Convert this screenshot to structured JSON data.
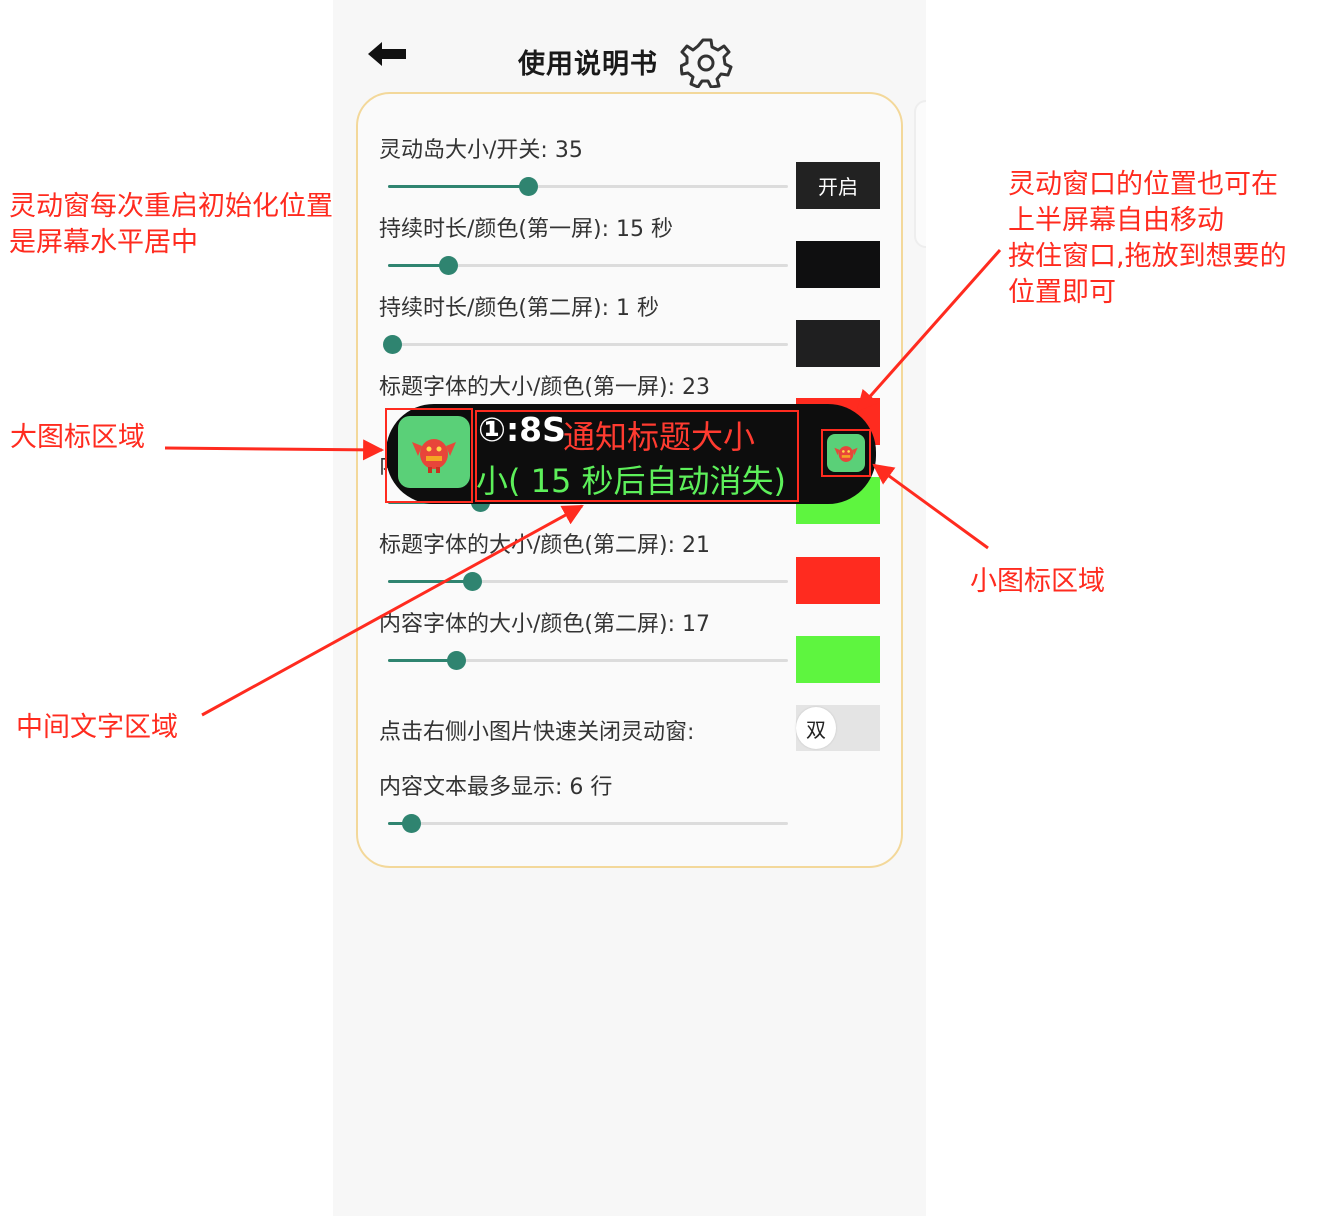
{
  "header": {
    "title": "使用说明书",
    "back_icon": "arrow-left-icon",
    "settings_icon": "gear-icon"
  },
  "settings": [
    {
      "label": "灵动岛大小/开关: 35",
      "value": 35,
      "slider_fraction": 0.35,
      "control": "button",
      "control_label": "开启"
    },
    {
      "label": "持续时长/颜色(第一屏): 15 秒",
      "value": 15,
      "slider_fraction": 0.15,
      "control": "swatch",
      "color": "#0f0f10"
    },
    {
      "label": "持续时长/颜色(第二屏): 1 秒",
      "value": 1,
      "slider_fraction": 0.01,
      "control": "swatch",
      "color": "#1f1f20"
    },
    {
      "label": "标题字体的大小/颜色(第一屏): 23",
      "value": 23,
      "control": "swatch",
      "color": "#ff2b1f"
    },
    {
      "label": "内容字体的大小/颜色(第一屏)",
      "control": "swatch",
      "color": "#5ef53f"
    },
    {
      "label": "标题字体的大小/颜色(第二屏): 21",
      "value": 21,
      "slider_fraction": 0.21,
      "control": "swatch",
      "color": "#ff2b1f"
    },
    {
      "label": "内容字体的大小/颜色(第二屏): 17",
      "value": 17,
      "slider_fraction": 0.17,
      "control": "swatch",
      "color": "#5ef53f"
    },
    {
      "label": "点击右侧小图片快速关闭灵动窗:",
      "control": "switch",
      "control_label": "双"
    },
    {
      "label": "内容文本最多显示: 6 行",
      "value": 6,
      "slider_fraction": 0.06
    }
  ],
  "island": {
    "prefix": "①:8S",
    "title": "通知标题大小",
    "content": "小( 15 秒后自动消失)",
    "big_icon": "red-mascot-icon",
    "small_icon": "red-mascot-icon",
    "background": "#0d0d0d",
    "icon_bg": "#5ad078"
  },
  "annotations": {
    "reset_line1": "灵动窗每次重启初始化位置",
    "reset_line2": "是屏幕水平居中",
    "move_line1": "灵动窗口的位置也可在",
    "move_line2": "上半屏幕自由移动",
    "move_line3": "按住窗口,拖放到想要的",
    "move_line4": "位置即可",
    "big_icon_area": "大图标区域",
    "small_icon_area": "小图标区域",
    "middle_text_area": "中间文字区域",
    "color": "#ff2b1f"
  },
  "colors": {
    "accent": "#2f8470",
    "panel_border": "#f3d89a",
    "annotation": "#ff2b1f"
  }
}
